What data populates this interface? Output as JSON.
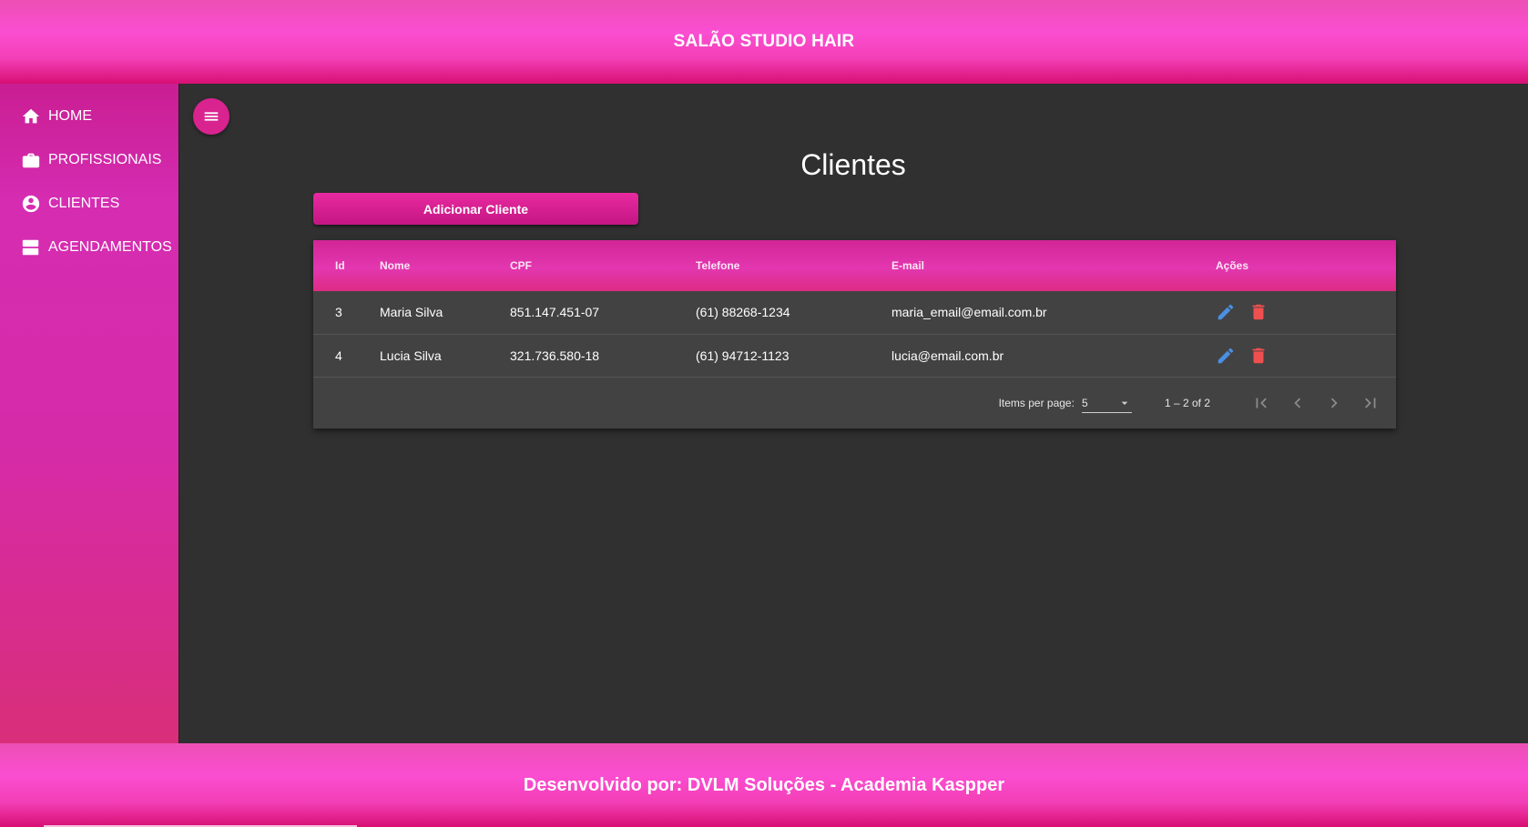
{
  "header": {
    "title": "SALÃO STUDIO HAIR"
  },
  "sidebar": {
    "items": [
      {
        "label": "HOME",
        "icon": "home-icon"
      },
      {
        "label": "PROFISSIONAIS",
        "icon": "briefcase-icon"
      },
      {
        "label": "CLIENTES",
        "icon": "account-circle-icon"
      },
      {
        "label": "AGENDAMENTOS",
        "icon": "view-agenda-icon"
      }
    ]
  },
  "main": {
    "title": "Clientes",
    "add_button_label": "Adicionar Cliente",
    "table": {
      "columns": [
        "Id",
        "Nome",
        "CPF",
        "Telefone",
        "E-mail",
        "Ações"
      ],
      "rows": [
        {
          "id": "3",
          "nome": "Maria Silva",
          "cpf": "851.147.451-07",
          "telefone": "(61) 88268-1234",
          "email": "maria_email@email.com.br"
        },
        {
          "id": "4",
          "nome": "Lucia Silva",
          "cpf": "321.736.580-18",
          "telefone": "(61) 94712-1123",
          "email": "lucia@email.com.br"
        }
      ]
    },
    "paginator": {
      "items_per_page_label": "Items per page:",
      "items_per_page_value": "5",
      "range_label": "1 – 2 of 2"
    }
  },
  "footer": {
    "text": "Desenvolvido por: DVLM Soluções - Academia Kaspper"
  },
  "colors": {
    "accent": "#d9238f",
    "edit": "#4a8fe3",
    "delete": "#ef4f4f",
    "background": "#303030"
  }
}
